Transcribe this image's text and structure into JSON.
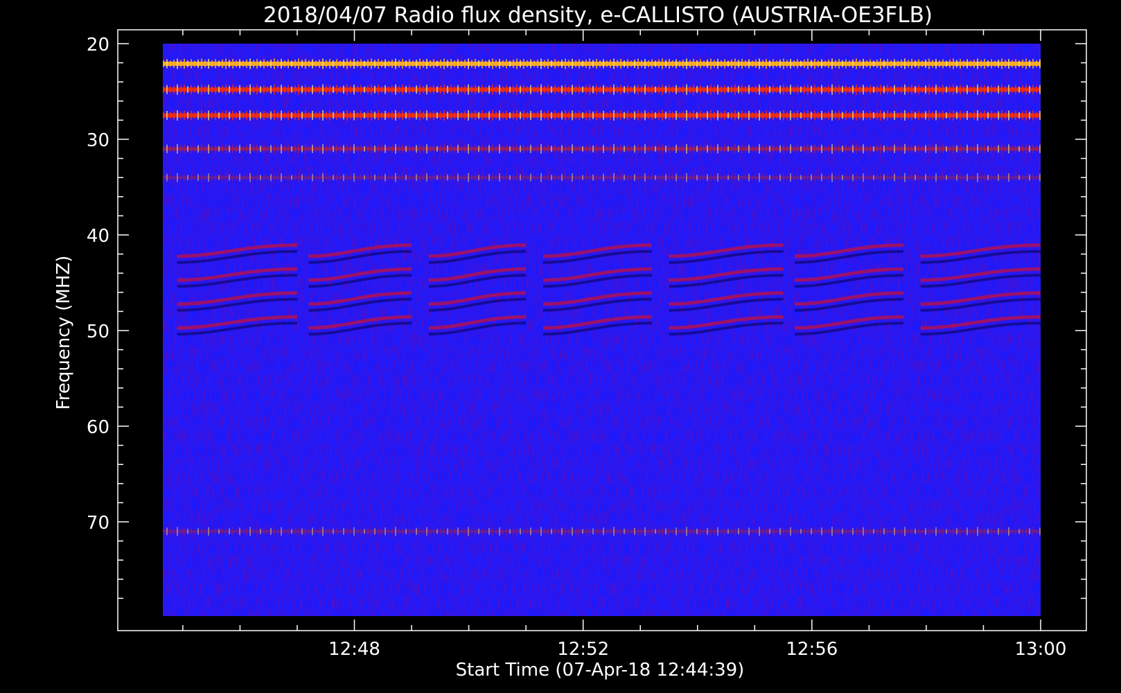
{
  "chart_data": {
    "type": "heatmap",
    "title": "2018/04/07  Radio flux density, e-CALLISTO (AUSTRIA-OE3FLB)",
    "xlabel": "Start Time (07-Apr-18 12:44:39)",
    "ylabel": "Frequency (MHZ)",
    "x_range": [
      "12:44:39",
      "13:00:00"
    ],
    "y_range_mhz": [
      20,
      80
    ],
    "y_axis_inverted": true,
    "x_ticks": [
      "12:48",
      "12:52",
      "12:56",
      "13:00"
    ],
    "x_tick_minutes": [
      228,
      232,
      236,
      240
    ],
    "y_ticks": [
      20,
      30,
      40,
      50,
      60,
      70
    ],
    "colormap": [
      "#000000",
      "#0000ff",
      "#ff0000",
      "#ffff00"
    ],
    "background_color": "#1a1aff",
    "interference_bands_mhz": [
      {
        "mhz": 22.1,
        "intensity": "very high"
      },
      {
        "mhz": 24.8,
        "intensity": "high"
      },
      {
        "mhz": 27.5,
        "intensity": "high"
      },
      {
        "mhz": 31,
        "intensity": "moderate"
      },
      {
        "mhz": 34,
        "intensity": "low"
      },
      {
        "mhz": 71,
        "intensity": "low"
      }
    ],
    "drifting_band_group_mhz": [
      41.5,
      44,
      46.5,
      49
    ],
    "grid": false
  }
}
